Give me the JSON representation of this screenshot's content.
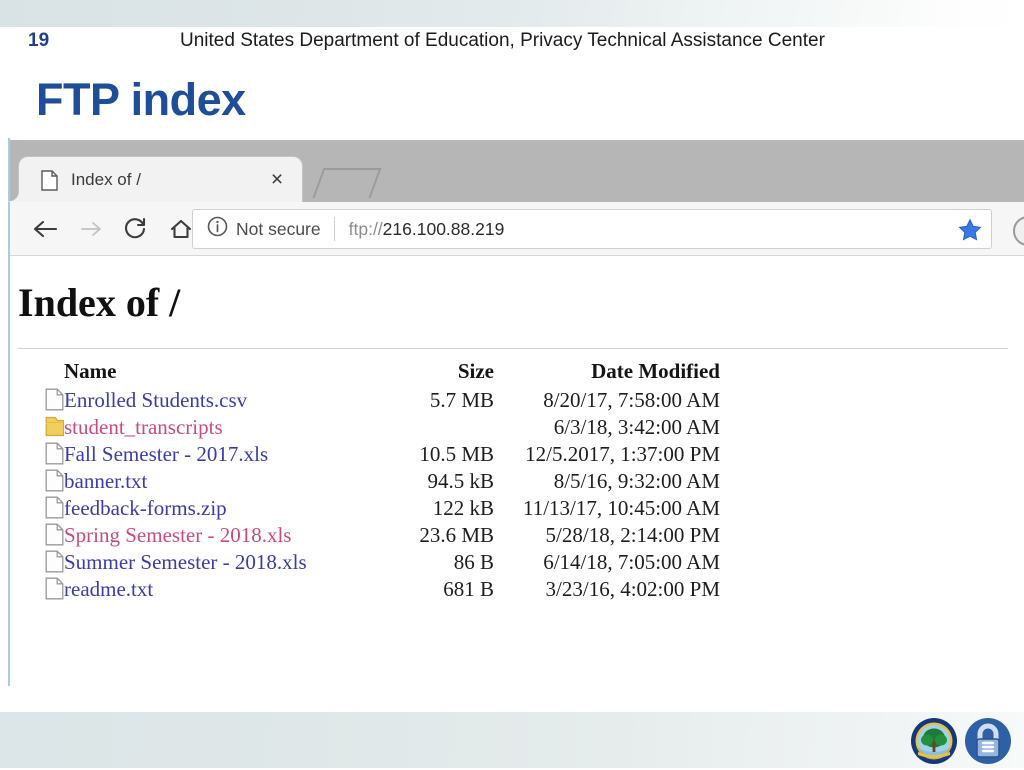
{
  "slide": {
    "title": "FTP index",
    "number": "19",
    "footer_text": "United States Department of Education, Privacy Technical Assistance Center",
    "title_color": "#1f4e99",
    "number_color": "#22408c"
  },
  "browser": {
    "tab": {
      "title": "Index of /",
      "favicon": "page-icon",
      "close": "×"
    },
    "newtab_label": "",
    "toolbar": {
      "back_icon": "back-arrow-icon",
      "forward_icon": "forward-arrow-icon",
      "reload_icon": "reload-icon",
      "home_icon": "home-icon",
      "security_icon": "info-circle-icon",
      "security_label": "Not secure",
      "url_scheme": "ftp://",
      "url_host": "216.100.88.219",
      "bookmark_icon": "star-icon",
      "bookmark_color": "#3b78e7",
      "profile_icon": "profile-avatar-icon"
    }
  },
  "page": {
    "heading": "Index of /",
    "columns": {
      "icon": "",
      "name": "Name",
      "size": "Size",
      "date": "Date Modified"
    },
    "link_color_unvisited": "#3b3ba8",
    "link_color_visited": "#c74b7e",
    "rows": [
      {
        "icon": "file-icon",
        "name": "Enrolled Students.csv",
        "size": "5.7 MB",
        "date": "8/20/17, 7:58:00 AM",
        "visited": false
      },
      {
        "icon": "folder-icon",
        "name": "student_transcripts",
        "size": "",
        "date": "6/3/18, 3:42:00 AM",
        "visited": true
      },
      {
        "icon": "file-icon",
        "name": "Fall Semester - 2017.xls",
        "size": "10.5 MB",
        "date": "12/5.2017, 1:37:00 PM",
        "visited": false
      },
      {
        "icon": "file-icon",
        "name": "banner.txt",
        "size": "94.5 kB",
        "date": "8/5/16, 9:32:00 AM",
        "visited": false
      },
      {
        "icon": "file-icon",
        "name": "feedback-forms.zip",
        "size": "122 kB",
        "date": "11/13/17, 10:45:00 AM",
        "visited": false
      },
      {
        "icon": "file-icon",
        "name": "Spring Semester - 2018.xls",
        "size": "23.6 MB",
        "date": "5/28/18, 2:14:00 PM",
        "visited": true
      },
      {
        "icon": "file-icon",
        "name": "Summer Semester - 2018.xls",
        "size": "86 B",
        "date": "6/14/18, 7:05:00 AM",
        "visited": false
      },
      {
        "icon": "file-icon",
        "name": "readme.txt",
        "size": "681 B",
        "date": "3/23/16, 4:02:00 PM",
        "visited": false
      }
    ]
  },
  "logos": [
    {
      "name": "dept-of-education-seal-logo"
    },
    {
      "name": "ptac-padlock-logo"
    }
  ]
}
